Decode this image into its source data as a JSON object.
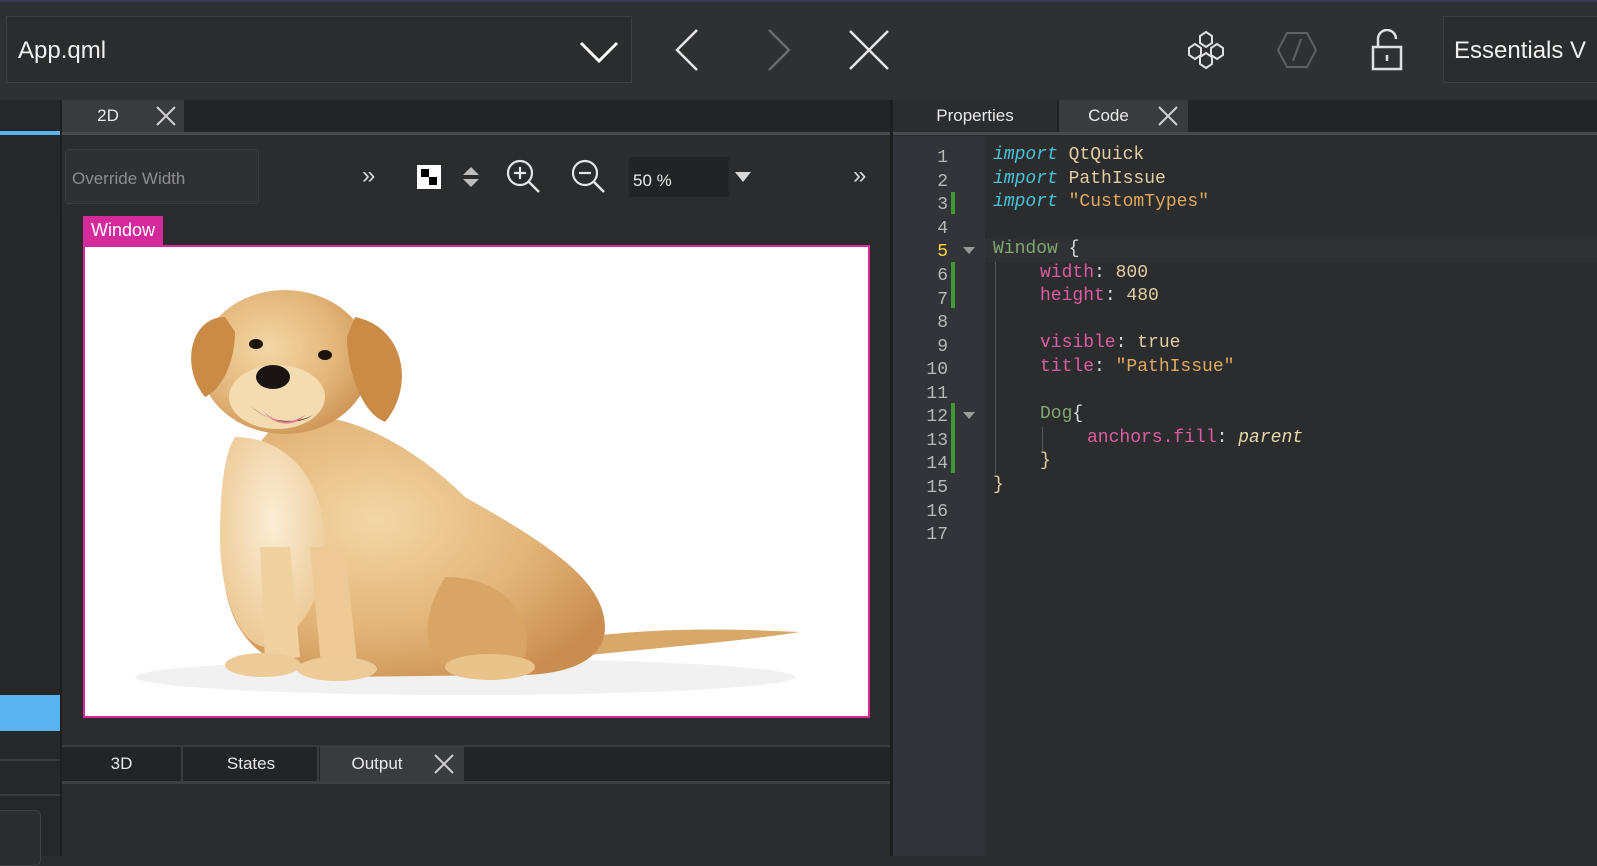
{
  "topbar": {
    "file_name": "App.qml",
    "workspace_label": "Essentials V"
  },
  "editor": {
    "tab_label": "2D",
    "override_width_placeholder": "Override Width",
    "zoom_value": "50 %",
    "window_tag": "Window"
  },
  "bottom_tabs": {
    "tab_3d": "3D",
    "tab_states": "States",
    "tab_output": "Output"
  },
  "right_tabs": {
    "properties": "Properties",
    "code": "Code"
  },
  "code": {
    "line_numbers": [
      "1",
      "2",
      "3",
      "4",
      "5",
      "6",
      "7",
      "8",
      "9",
      "10",
      "11",
      "12",
      "13",
      "14",
      "15",
      "16",
      "17"
    ],
    "current_line": "5",
    "l1_kw": "import",
    "l1_rest": " QtQuick",
    "l2_kw": "import",
    "l2_rest": " PathIssue",
    "l3_kw": "import",
    "l3_str": " \"CustomTypes\"",
    "l5_type": "Window",
    "l5_brace": " {",
    "l6_prop": "width",
    "l6_colon": ": ",
    "l6_val": "800",
    "l7_prop": "height",
    "l7_colon": ": ",
    "l7_val": "480",
    "l9_prop": "visible",
    "l9_colon": ": ",
    "l9_val": "true",
    "l10_prop": "title",
    "l10_colon": ": ",
    "l10_val": "\"PathIssue\"",
    "l12_type": "Dog",
    "l12_brace": "{",
    "l13_prop": "anchors.fill",
    "l13_colon": ": ",
    "l13_val": "parent",
    "l14_brace": "}",
    "l15_brace": "}"
  },
  "colors": {
    "accent_pink": "#d42a9c",
    "accent_blue": "#5ab4f3",
    "current_line_number": "#ffd23c",
    "change_marker": "#3f9b2f"
  }
}
